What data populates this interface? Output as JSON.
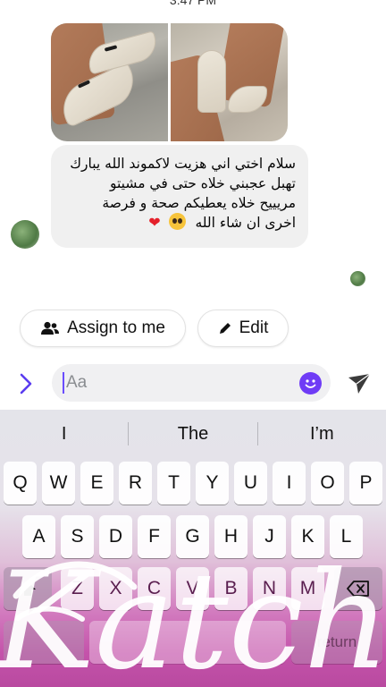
{
  "status_bar": {
    "time": "3:47 PM"
  },
  "message": {
    "lines": [
      "سلام اختي اني هزيت لاكموند الله يبارك",
      "تهبل عجبني خلاه حتى في مشيتو",
      "مريييح خلاه يعطيكم صحة و فرصة",
      "اخرى ان شاء الله"
    ],
    "emojis": [
      "pleading-face-icon",
      "red-heart-icon"
    ]
  },
  "actions": {
    "assign_label": "Assign to me",
    "edit_label": "Edit"
  },
  "composer": {
    "placeholder": "Aa"
  },
  "keyboard": {
    "suggestions": [
      "I",
      "The",
      "I’m"
    ],
    "row1": [
      "Q",
      "W",
      "E",
      "R",
      "T",
      "Y",
      "U",
      "I",
      "O",
      "P"
    ],
    "row2": [
      "A",
      "S",
      "D",
      "F",
      "G",
      "H",
      "J",
      "K",
      "L"
    ],
    "row3": [
      "Z",
      "X",
      "C",
      "V",
      "B",
      "N",
      "M"
    ],
    "return_label": "return"
  },
  "watermark": {
    "text": "Katchita"
  },
  "colors": {
    "accent": "#6f3cf6",
    "heart": "#e4202a",
    "keyboard_pink": "#c452aa"
  }
}
